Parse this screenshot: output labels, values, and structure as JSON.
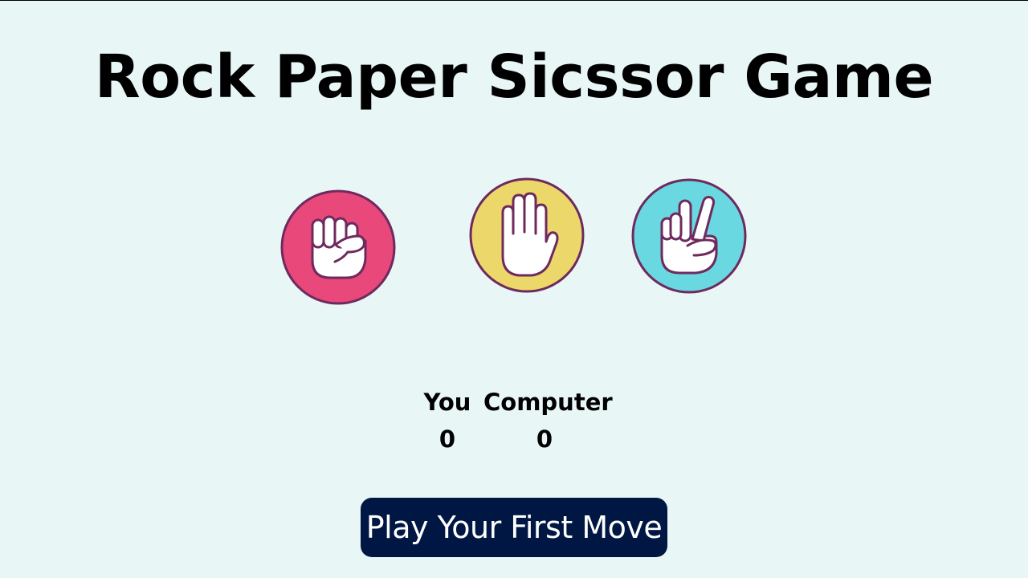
{
  "game": {
    "title": "Rock Paper Sicssor Game"
  },
  "choices": [
    {
      "id": "rock",
      "icon": "fist-icon",
      "color": "#e8487a"
    },
    {
      "id": "paper",
      "icon": "open-hand-icon",
      "color": "#ecd86a"
    },
    {
      "id": "scissors",
      "icon": "peace-sign-icon",
      "color": "#6ad8e0"
    }
  ],
  "score": {
    "you_label": "You",
    "you_value": "0",
    "computer_label": "Computer",
    "computer_value": "0"
  },
  "message": {
    "text": "Play Your First Move",
    "background": "#001744"
  },
  "colors": {
    "background": "#e8f6f6",
    "outline": "#6e2a5e"
  }
}
